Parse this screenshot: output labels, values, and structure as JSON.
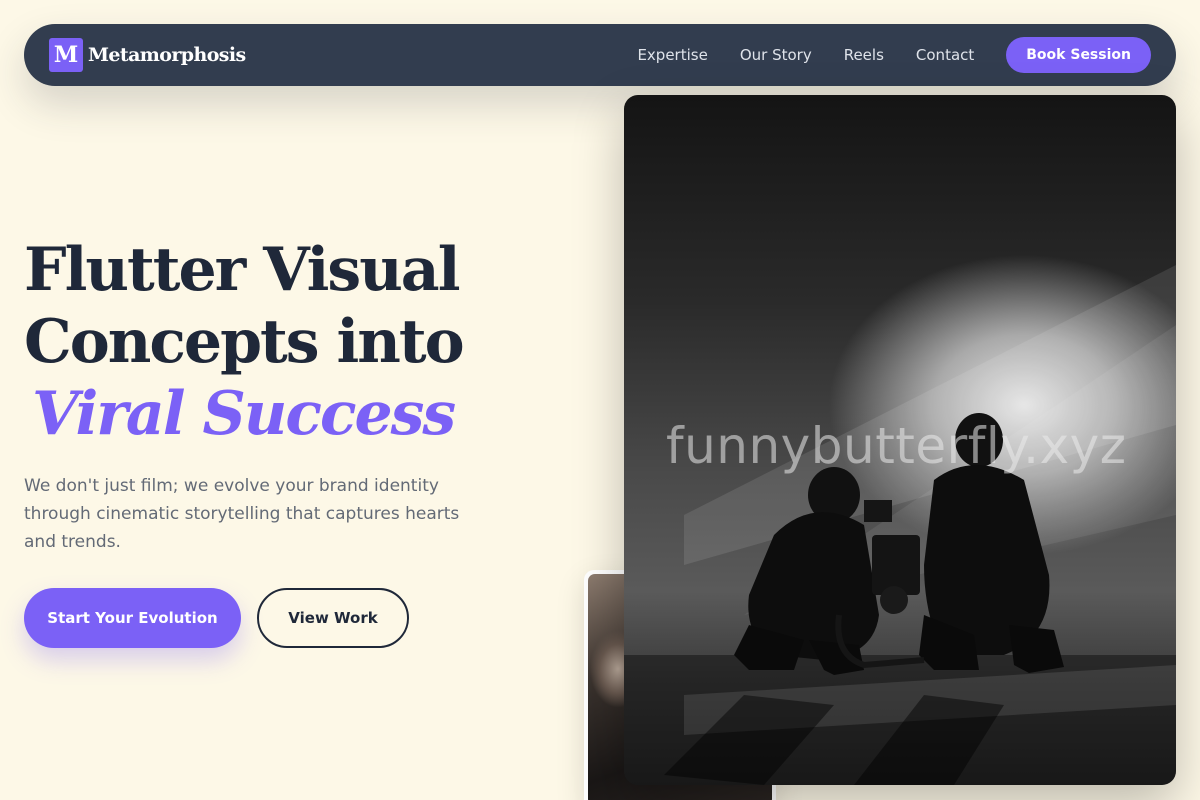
{
  "brand": {
    "logo_letter": "M",
    "name": "Metamorphosis"
  },
  "nav": {
    "links": [
      "Expertise",
      "Our Story",
      "Reels",
      "Contact"
    ],
    "cta": "Book Session"
  },
  "hero": {
    "title_line1": "Flutter Visual",
    "title_line2": "Concepts into",
    "title_accent": "Viral Success",
    "subtitle": "We don't just film; we evolve your brand identity through cinematic storytelling that captures hearts and trends.",
    "primary_button": "Start Your Evolution",
    "secondary_button": "View Work"
  },
  "image": {
    "watermark": "funnybutterfly.xyz",
    "alt": "Two camera operators crouching with film camera rig in a hazy studio"
  },
  "colors": {
    "background": "#fdf8e7",
    "navbar": "#323d4f",
    "accent": "#7b61f6",
    "heading": "#1f2839",
    "body_text": "#636a76"
  }
}
